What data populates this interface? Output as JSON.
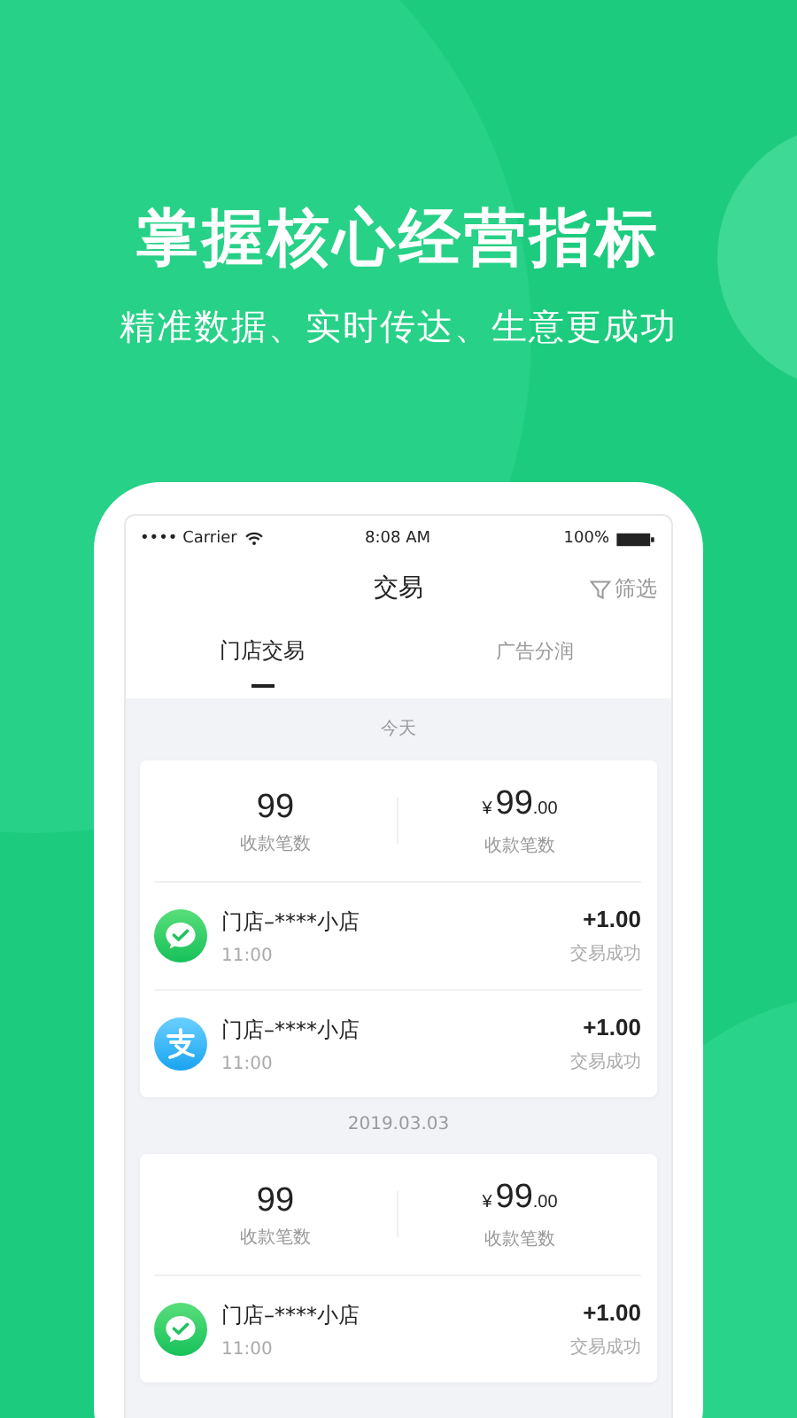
{
  "headline": "掌握核心经营指标",
  "subtitle": "精准数据、实时传达、生意更成功",
  "status_bar": {
    "carrier": "•••• Carrier",
    "time": "8:08 AM",
    "battery": "100%"
  },
  "nav": {
    "title": "交易",
    "filter": "筛选"
  },
  "tabs": [
    {
      "label": "门店交易",
      "selected": true
    },
    {
      "label": "广告分润",
      "selected": false
    }
  ],
  "groups": [
    {
      "date": "今天",
      "stats": {
        "count": "99",
        "count_label": "收款笔数",
        "currency": "¥",
        "amount": "99",
        "decimals": ".00",
        "amount_label": "收款笔数"
      },
      "rows": [
        {
          "kind": "wechat",
          "name": "门店–****小店",
          "time": "11:00",
          "amount": "+1.00",
          "status": "交易成功"
        },
        {
          "kind": "alipay",
          "name": "门店–****小店",
          "time": "11:00",
          "amount": "+1.00",
          "status": "交易成功"
        }
      ]
    },
    {
      "date": "2019.03.03",
      "stats": {
        "count": "99",
        "count_label": "收款笔数",
        "currency": "¥",
        "amount": "99",
        "decimals": ".00",
        "amount_label": "收款笔数"
      },
      "rows": [
        {
          "kind": "wechat",
          "name": "门店–****小店",
          "time": "11:00",
          "amount": "+1.00",
          "status": "交易成功"
        }
      ]
    }
  ]
}
